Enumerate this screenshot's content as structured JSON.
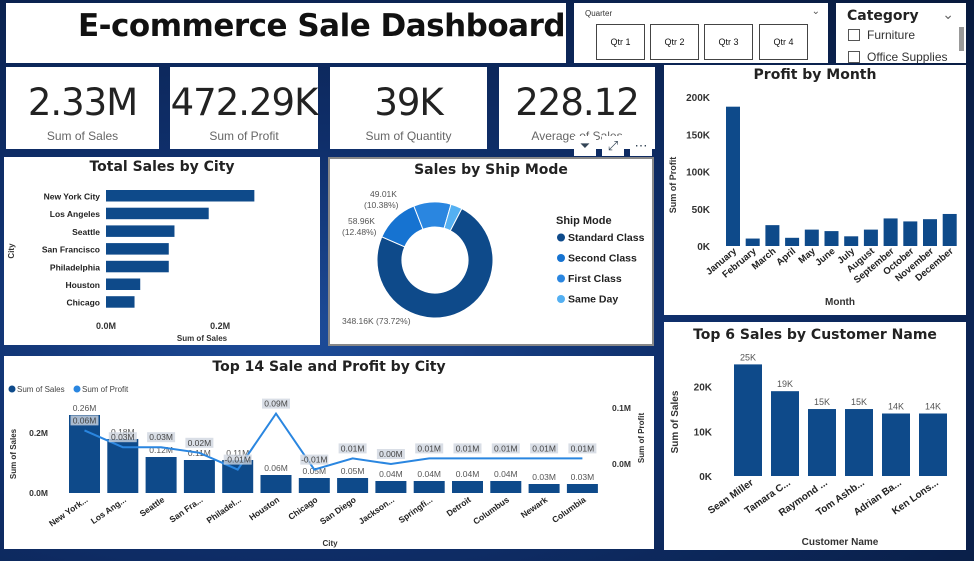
{
  "title": "E-commerce Sale Dashboard",
  "slicers": {
    "quarter": {
      "label": "Quarter",
      "options": [
        "Qtr 1",
        "Qtr 2",
        "Qtr 3",
        "Qtr 4"
      ]
    },
    "category": {
      "label": "Category",
      "options": [
        "Furniture",
        "Office Supplies"
      ]
    }
  },
  "kpis": [
    {
      "value": "2.33M",
      "label": "Sum of Sales"
    },
    {
      "value": "472.29K",
      "label": "Sum of Profit"
    },
    {
      "value": "39K",
      "label": "Sum of Quantity"
    },
    {
      "value": "228.12",
      "label": "Average of Sales"
    }
  ],
  "chart_data": [
    {
      "id": "total_sales_by_city",
      "type": "bar",
      "orientation": "horizontal",
      "title": "Total Sales by City",
      "xlabel": "Sum of Sales",
      "ylabel": "City",
      "categories": [
        "New York City",
        "Los Angeles",
        "Seattle",
        "San Francisco",
        "Philadelphia",
        "Houston",
        "Chicago"
      ],
      "values": [
        0.26,
        0.18,
        0.12,
        0.11,
        0.11,
        0.06,
        0.05
      ],
      "xticks": [
        "0.0M",
        "0.2M"
      ],
      "xlim": [
        0,
        0.34
      ],
      "color": "#0e4a8a"
    },
    {
      "id": "sales_by_ship_mode",
      "type": "pie",
      "subtype": "donut",
      "title": "Sales by Ship Mode",
      "legend_title": "Ship Mode",
      "legend_position": "right",
      "categories": [
        "Standard Class",
        "Second Class",
        "First Class",
        "Same Day"
      ],
      "values": [
        348.16,
        58.96,
        49.01,
        15.0
      ],
      "data_labels": [
        "348.16K (73.72%)",
        "58.96K (12.48%)",
        "49.01K (10.38%)",
        ""
      ],
      "colors": [
        "#0e4a8a",
        "#1673d1",
        "#2a86e0",
        "#54b0f2"
      ]
    },
    {
      "id": "profit_by_month",
      "type": "bar",
      "title": "Profit by Month",
      "xlabel": "Month",
      "ylabel": "Sum of Profit",
      "categories": [
        "January",
        "February",
        "March",
        "April",
        "May",
        "June",
        "July",
        "August",
        "September",
        "October",
        "November",
        "December"
      ],
      "values": [
        187000,
        10000,
        28000,
        11000,
        22000,
        20000,
        13000,
        22000,
        37000,
        33000,
        36000,
        43000
      ],
      "yticks": [
        "0K",
        "50K",
        "100K",
        "150K",
        "200K"
      ],
      "ylim": [
        0,
        200000
      ],
      "color": "#0e4a8a"
    },
    {
      "id": "top14_sale_profit_by_city",
      "type": "bar",
      "combo": "bar+line",
      "title": "Top 14 Sale and Profit by City",
      "xlabel": "City",
      "ylabel": "Sum of Sales",
      "y2label": "Sum of Profit",
      "legend_position": "top-left",
      "categories": [
        "New York...",
        "Los Ang...",
        "Seattle",
        "San Fra...",
        "Philadel...",
        "Houston",
        "Chicago",
        "San Diego",
        "Jackson...",
        "Springfi...",
        "Detroit",
        "Columbus",
        "Newark",
        "Columbia"
      ],
      "series": [
        {
          "name": "Sum of Sales",
          "values": [
            0.26,
            0.18,
            0.12,
            0.11,
            0.11,
            0.06,
            0.05,
            0.05,
            0.04,
            0.04,
            0.04,
            0.04,
            0.03,
            0.03
          ],
          "labels": [
            "0.26M",
            "0.18M",
            "0.12M",
            "0.11M",
            "0.11M",
            "0.06M",
            "0.05M",
            "0.05M",
            "0.04M",
            "0.04M",
            "0.04M",
            "0.04M",
            "0.03M",
            "0.03M"
          ],
          "color": "#0e4a8a"
        },
        {
          "name": "Sum of Profit",
          "values": [
            0.06,
            0.03,
            0.03,
            0.02,
            -0.01,
            0.09,
            -0.01,
            0.01,
            0.0,
            0.01,
            0.01,
            0.01,
            0.01,
            0.01
          ],
          "labels": [
            "0.06M",
            "0.03M",
            "0.03M",
            "0.02M",
            "-0.01M",
            "0.09M",
            "-0.01M",
            "0.01M",
            "0.00M",
            "0.01M",
            "0.01M",
            "0.01M",
            "0.01M",
            "0.01M"
          ],
          "color": "#2a86e0"
        }
      ],
      "yticks": [
        "0.0M",
        "0.2M"
      ],
      "y2ticks": [
        "0.0M",
        "0.1M"
      ],
      "ylim": [
        0,
        0.3
      ],
      "y2lim": [
        -0.025,
        0.13
      ]
    },
    {
      "id": "top6_sales_by_customer",
      "type": "bar",
      "title": "Top 6 Sales by Customer Name",
      "xlabel": "Customer Name",
      "ylabel": "Sum of Sales",
      "categories": [
        "Sean Miller",
        "Tamara C...",
        "Raymond ...",
        "Tom Ashb...",
        "Adrian Ba...",
        "Ken Lons..."
      ],
      "values": [
        25000,
        19000,
        15000,
        15000,
        14000,
        14000
      ],
      "data_labels": [
        "25K",
        "19K",
        "15K",
        "15K",
        "14K",
        "14K"
      ],
      "yticks": [
        "0K",
        "10K",
        "20K"
      ],
      "ylim": [
        0,
        28000
      ],
      "color": "#0e4a8a"
    }
  ]
}
